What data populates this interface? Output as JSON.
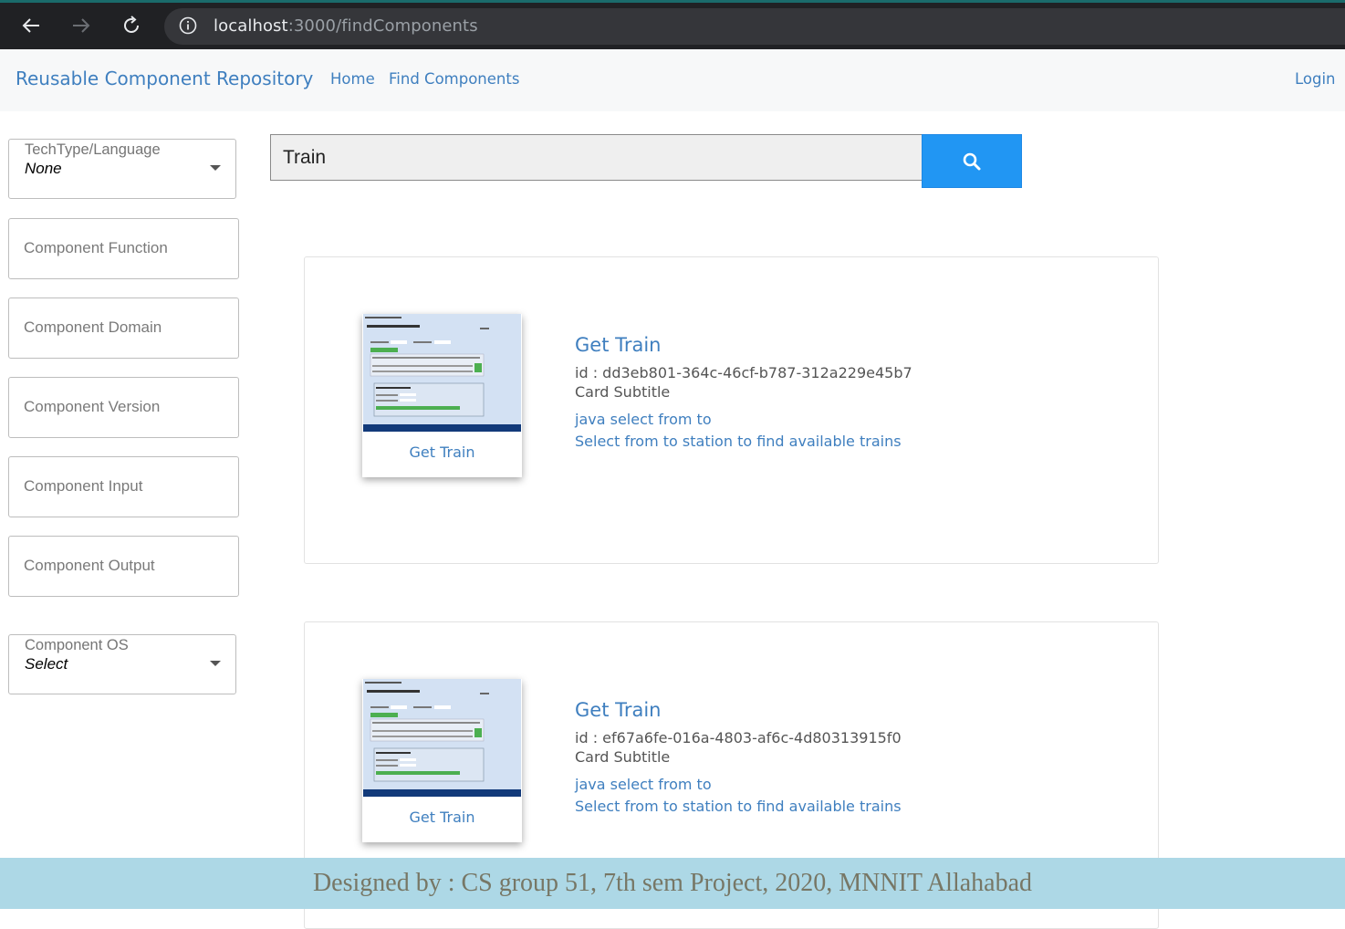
{
  "browser": {
    "host": "localhost",
    "path": ":3000/findComponents"
  },
  "navbar": {
    "brand": "Reusable Component Repository",
    "links": [
      "Home",
      "Find Components"
    ],
    "login": "Login"
  },
  "filters": {
    "techtype": {
      "label": "TechType/Language",
      "value": "None"
    },
    "fields": [
      {
        "placeholder": "Component Function"
      },
      {
        "placeholder": "Component Domain"
      },
      {
        "placeholder": "Component Version"
      },
      {
        "placeholder": "Component Input"
      },
      {
        "placeholder": "Component Output"
      }
    ],
    "os": {
      "label": "Component OS",
      "value": "Select"
    }
  },
  "search": {
    "value": "Train"
  },
  "results": [
    {
      "thumb_caption": "Get Train",
      "title": "Get Train",
      "id": "id : dd3eb801-364c-46cf-b787-312a229e45b7",
      "subtitle": "Card Subtitle",
      "tags": "java select from to",
      "description": "Select from to station to find available trains"
    },
    {
      "thumb_caption": "Get Train",
      "title": "Get Train",
      "id": "id : ef67a6fe-016a-4803-af6c-4d80313915f0",
      "subtitle": "Card Subtitle",
      "tags": "java select from to",
      "description": "Select from to station to find available trains"
    }
  ],
  "footer": {
    "text": "Designed by : CS group 51, 7th sem Project, 2020, MNNIT Allahabad"
  },
  "colors": {
    "link": "#3f7fbf",
    "search_button": "#2196f3",
    "footer_bg": "#add8e6"
  }
}
